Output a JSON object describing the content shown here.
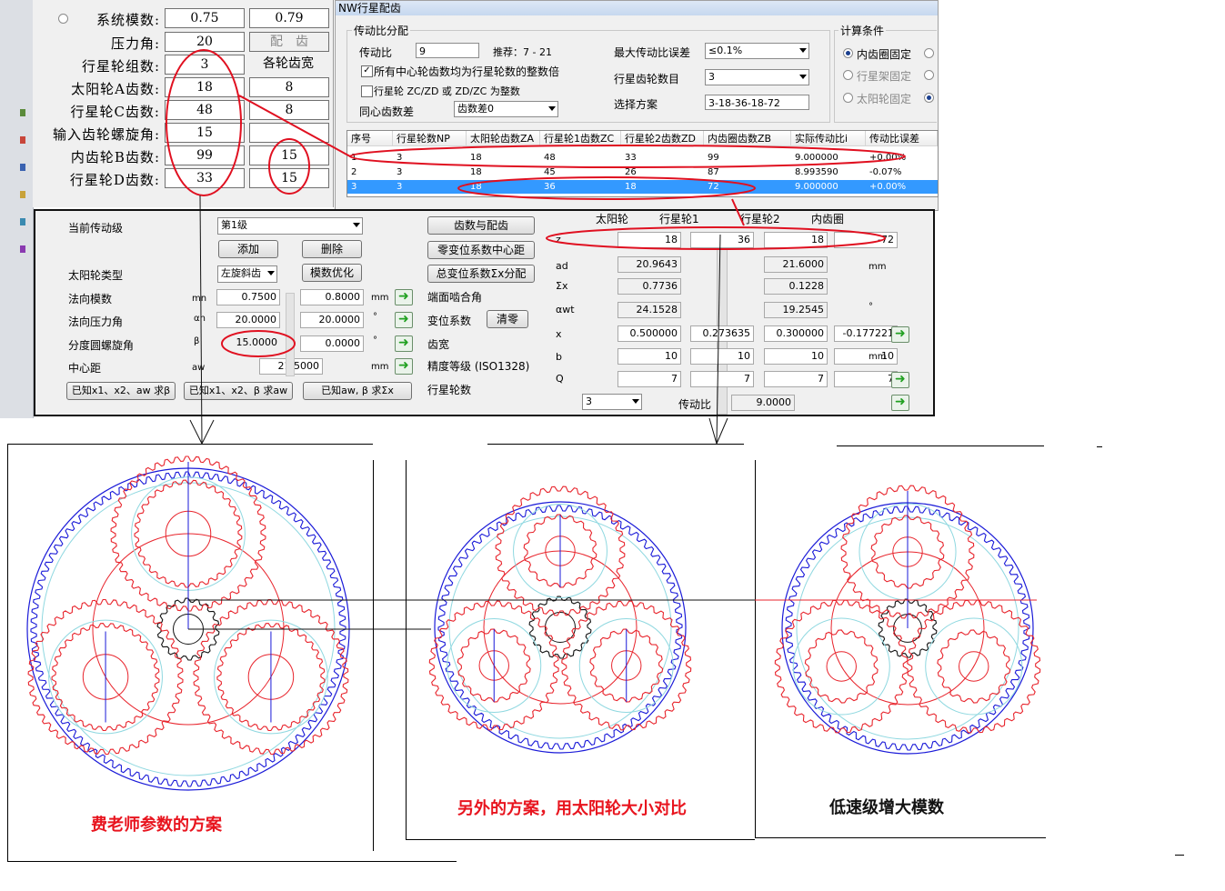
{
  "left_form": {
    "radio_selected": false,
    "rows": [
      {
        "label": "系统模数:",
        "v1": "0.75",
        "v2": "0.79"
      },
      {
        "label": "压力角:",
        "v1": "20",
        "v2": "配　齿"
      },
      {
        "label": "行星轮组数:",
        "v1": "3",
        "v2": "各轮齿宽"
      },
      {
        "label": "太阳轮A齿数:",
        "v1": "18",
        "v2": "8"
      },
      {
        "label": "行星轮C齿数:",
        "v1": "48",
        "v2": "8"
      },
      {
        "label": "输入齿轮螺旋角:",
        "v1": "15",
        "v2": ""
      },
      {
        "label": "内齿轮B齿数:",
        "v1": "99",
        "v2": "15"
      },
      {
        "label": "行星轮D齿数:",
        "v1": "33",
        "v2": "15"
      }
    ]
  },
  "nw_window": {
    "title": "NW行星配齿",
    "ratio_group": {
      "title": "传动比分配",
      "ratio_label": "传动比",
      "ratio_value": "9",
      "recommend_text": "推荐：7 - 21",
      "max_err_label": "最大传动比误差",
      "max_err_value": "≤0.1%",
      "planet_count_label": "行星齿轮数目",
      "planet_count_value": "3",
      "scheme_label": "选择方案",
      "scheme_value": "3-18-36-18-72",
      "check1_label": "所有中心轮齿数均为行星轮数的整数倍",
      "check1_checked": "✓",
      "check2_label": "行星轮 ZC/ZD 或 ZD/ZC 为整数",
      "concentric_label": "同心齿数差",
      "concentric_value": "齿数差0"
    },
    "calc_group": {
      "title": "计算条件",
      "options": [
        "内齿圈固定",
        "行星架固定",
        "太阳轮固定"
      ]
    },
    "table": {
      "headers": [
        "序号",
        "行星轮数NP",
        "太阳轮齿数ZA",
        "行星轮1齿数ZC",
        "行星轮2齿数ZD",
        "内齿圈齿数ZB",
        "实际传动比i",
        "传动比误差"
      ],
      "rows": [
        [
          "1",
          "3",
          "18",
          "48",
          "33",
          "99",
          "9.000000",
          "+0.00%"
        ],
        [
          "2",
          "3",
          "18",
          "45",
          "26",
          "87",
          "8.993590",
          "-0.07%"
        ],
        [
          "3",
          "3",
          "18",
          "36",
          "18",
          "72",
          "9.000000",
          "+0.00%"
        ]
      ],
      "selected_row": 2
    }
  },
  "detail": {
    "stage_label": "当前传动级",
    "stage_value": "第1级",
    "add_label": "添加",
    "delete_label": "删除",
    "sun_type_label": "太阳轮类型",
    "sun_type_value": "左旋斜齿",
    "mod_opt_label": "模数优化",
    "normal_module_label": "法向模数",
    "normal_module_sym": "mn",
    "normal_module_v1": "0.7500",
    "normal_module_v2": "0.8000",
    "normal_module_unit": "mm",
    "normal_angle_label": "法向压力角",
    "normal_angle_sym": "αn",
    "normal_angle_v1": "20.0000",
    "normal_angle_v2": "20.0000",
    "deg": "°",
    "helix_label": "分度圆螺旋角",
    "helix_sym": "β",
    "helix_v1": "15.0000",
    "helix_v2": "0.0000",
    "center_label": "中心距",
    "center_sym": "aw",
    "center_value": "21.5000",
    "center_unit": "mm",
    "btn_solve_beta": "已知x1、x2、aw 求β",
    "btn_solve_aw": "已知x1、x2、β 求aw",
    "btn_solve_sx": "已知aw, β 求Σx",
    "btn_teeth": "齿数与配齿",
    "btn_zero_shift": "零变位系数中心距",
    "btn_total_shift": "总变位系数Σx分配",
    "end_angle_label": "端面啮合角",
    "shift_label": "变位系数",
    "clear_label": "清零",
    "width_label": "齿宽",
    "precision_label": "精度等级 (ISO1328)",
    "planet_num_label": "行星轮数",
    "col_headers": [
      "太阳轮",
      "行星轮1",
      "行星轮2",
      "内齿圈"
    ],
    "row_z": {
      "sym": "z",
      "vals": [
        "18",
        "36",
        "18",
        "-72"
      ]
    },
    "row_ad": {
      "sym": "ad",
      "vals": [
        "20.9643",
        "21.6000"
      ],
      "unit": "mm"
    },
    "row_sx": {
      "sym": "Σx",
      "vals": [
        "0.7736",
        "0.1228"
      ]
    },
    "row_awt": {
      "sym": "αwt",
      "vals": [
        "24.1528",
        "19.2545"
      ],
      "unit": "°"
    },
    "row_x": {
      "sym": "x",
      "vals": [
        "0.500000",
        "0.273635",
        "0.300000",
        "-0.177221"
      ]
    },
    "row_b": {
      "sym": "b",
      "vals": [
        "10",
        "10",
        "10",
        "10"
      ],
      "unit": "mm"
    },
    "row_q": {
      "sym": "Q",
      "vals": [
        "7",
        "7",
        "7",
        "7"
      ]
    },
    "planet_combo": "3",
    "ratio_label": "传动比",
    "ratio_value": "9.0000"
  },
  "captions": {
    "c1": "费老师参数的方案",
    "c2": "另外的方案，用太阳轮大小对比",
    "c3": "低速级增大模数"
  },
  "colors": {
    "annotation_red": "#e01020",
    "gear_red": "#e8242c",
    "gear_blue": "#1a1ad8",
    "pitch_cyan": "#8fd8e0",
    "caption_red": "#e8141e",
    "caption_black": "#111111",
    "selection_blue": "#3399ff"
  }
}
